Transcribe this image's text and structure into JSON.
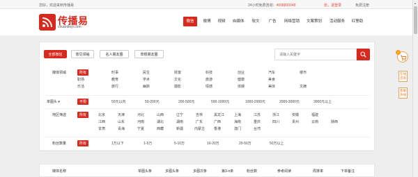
{
  "topbar": {
    "welcome": "您好，欢迎来到传播易",
    "hotline_label": "24小时免费咨询：",
    "hotline_number": "4008800048",
    "user": "张，退登录",
    "register": "免费注册"
  },
  "logo": {
    "name": "传播易",
    "site": "chuanboyi.com"
  },
  "nav": [
    "微信",
    "微博",
    "视频",
    "自媒体",
    "软文",
    "广告",
    "网络营销",
    "文案策划",
    "活动服务",
    "红警助"
  ],
  "tabs": [
    "全部微信",
    "意见领袖",
    "名人朋友圈",
    "草根朋友圈"
  ],
  "search": {
    "placeholder": "请输入关键字"
  },
  "filters": {
    "category": {
      "label": "媒体领域",
      "all": "所有",
      "rows": [
        [
          "时事",
          "民生",
          "财富",
          "科技",
          "创业",
          "汽车",
          "楼市"
        ],
        [
          "职场",
          "教育",
          "学术",
          "文化",
          "旅游",
          "健康",
          "美食"
        ],
        [
          "乐活",
          "旅行",
          "幽默",
          "情感",
          "体娱",
          "美体",
          "文摘"
        ]
      ],
      "extra": [
        "摄影"
      ]
    },
    "price": {
      "label": "单图头",
      "all": "不限",
      "options": [
        "50元以内",
        "50-200元",
        "200-500元",
        "500-1000元",
        "1000-2000元",
        "2000-3000元",
        "3000元以上"
      ]
    },
    "region": {
      "label": "地区筛选",
      "all": "所有",
      "rows": [
        [
          "北京",
          "天津",
          "河北",
          "山西",
          "辽宁",
          "吉林",
          "黑龙江",
          "上海",
          "江苏",
          "浙江",
          "安徽",
          "福建"
        ],
        [
          "江西",
          "山东",
          "河南",
          "湖北",
          "湖南",
          "广东",
          "广西",
          "海南",
          "重庆",
          "四川",
          "贵州",
          "云南",
          "陕西"
        ],
        [
          "甘肃",
          "青海",
          "宁夏",
          "西藏",
          "新疆",
          "内蒙古",
          "香港",
          "澳门",
          "台湾"
        ]
      ]
    },
    "fans": {
      "label": "粉丝数量",
      "all": "所有",
      "options": [
        "1万以下",
        "1-5万",
        "5-10万",
        "10-20万",
        "20-50万",
        "50万以上"
      ]
    }
  },
  "table_headers": [
    "媒体名称",
    "单图头条",
    "多图头条",
    "多图次条",
    "第3-n条",
    "粉丝数",
    "参考阅读",
    "周排率",
    "下单备注"
  ],
  "sidebar": {
    "cart_count": "0",
    "online": "在线咨询",
    "feedback": "客服热线"
  },
  "colors": {
    "brand": "#d8291f",
    "accent": "#e67e22"
  }
}
